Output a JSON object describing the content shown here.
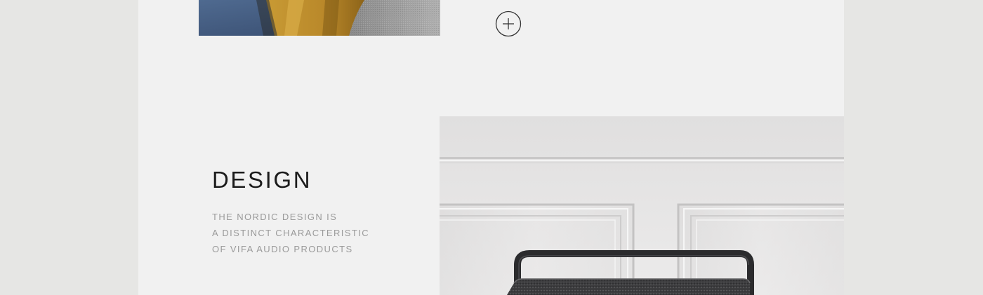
{
  "section": {
    "title": "DESIGN",
    "description_lines": [
      "THE NORDIC DESIGN IS",
      "A DISTINCT CHARACTERISTIC",
      "OF VIFA AUDIO PRODUCTS"
    ]
  },
  "icons": {
    "expand": "plus-circle-icon"
  },
  "colors": {
    "outer_background": "#e6e6e4",
    "page_background": "#f1f1f1",
    "title": "#1c1c1c",
    "description": "#9a9a9a"
  }
}
